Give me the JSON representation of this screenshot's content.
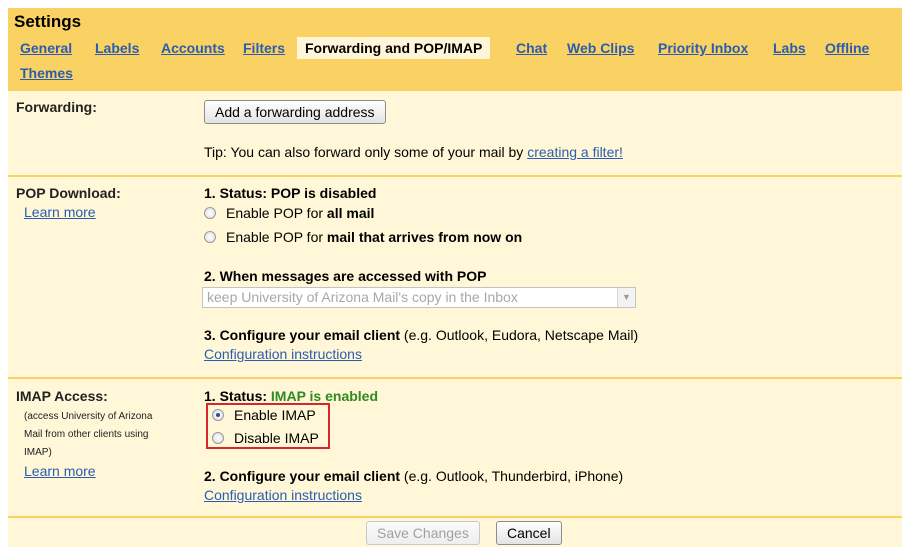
{
  "header": {
    "title": "Settings"
  },
  "tabs": [
    {
      "label": "General"
    },
    {
      "label": "Labels"
    },
    {
      "label": "Accounts"
    },
    {
      "label": "Filters"
    },
    {
      "label": "Forwarding and POP/IMAP"
    },
    {
      "label": "Chat"
    },
    {
      "label": "Web Clips"
    },
    {
      "label": "Priority Inbox"
    },
    {
      "label": "Labs"
    },
    {
      "label": "Offline"
    },
    {
      "label": "Themes"
    }
  ],
  "active_tab": "Forwarding and POP/IMAP",
  "forwarding": {
    "label": "Forwarding:",
    "add_button": "Add a forwarding address",
    "tip_prefix": "Tip: You can also forward only some of your mail by ",
    "tip_link": "creating a filter!"
  },
  "pop": {
    "label": "POP Download:",
    "learn_more": "Learn more",
    "status_prefix": "1. Status: POP is disabled",
    "option1_prefix": "Enable POP for ",
    "option1_bold": "all mail",
    "option2_prefix": "Enable POP for ",
    "option2_bold": "mail that arrives from now on",
    "when_heading": "2. When messages are accessed with POP",
    "when_select_value": "keep University of Arizona Mail's copy in the Inbox",
    "configure_bold": "3. Configure your email client",
    "configure_rest": " (e.g. Outlook, Eudora, Netscape Mail)",
    "config_link": "Configuration instructions"
  },
  "imap": {
    "label": "IMAP Access:",
    "note_line1": "(access University of Arizona",
    "note_line2": "Mail from other clients using",
    "note_line3": "IMAP)",
    "learn_more": "Learn more",
    "status_prefix": "1. Status: ",
    "status_value": "IMAP is enabled",
    "enable_label": "Enable IMAP",
    "disable_label": "Disable IMAP",
    "selected": "Enable IMAP",
    "configure_bold": "2. Configure your email client",
    "configure_rest": " (e.g. Outlook, Thunderbird, iPhone)",
    "config_link": "Configuration instructions"
  },
  "footer": {
    "save_button": "Save Changes",
    "cancel_button": "Cancel"
  },
  "colors": {
    "frame": "#fad163",
    "panel": "#fff7d7",
    "link": "#2a5db0",
    "enabled_green": "#2e8b1f",
    "highlight_red": "#d9262c"
  }
}
